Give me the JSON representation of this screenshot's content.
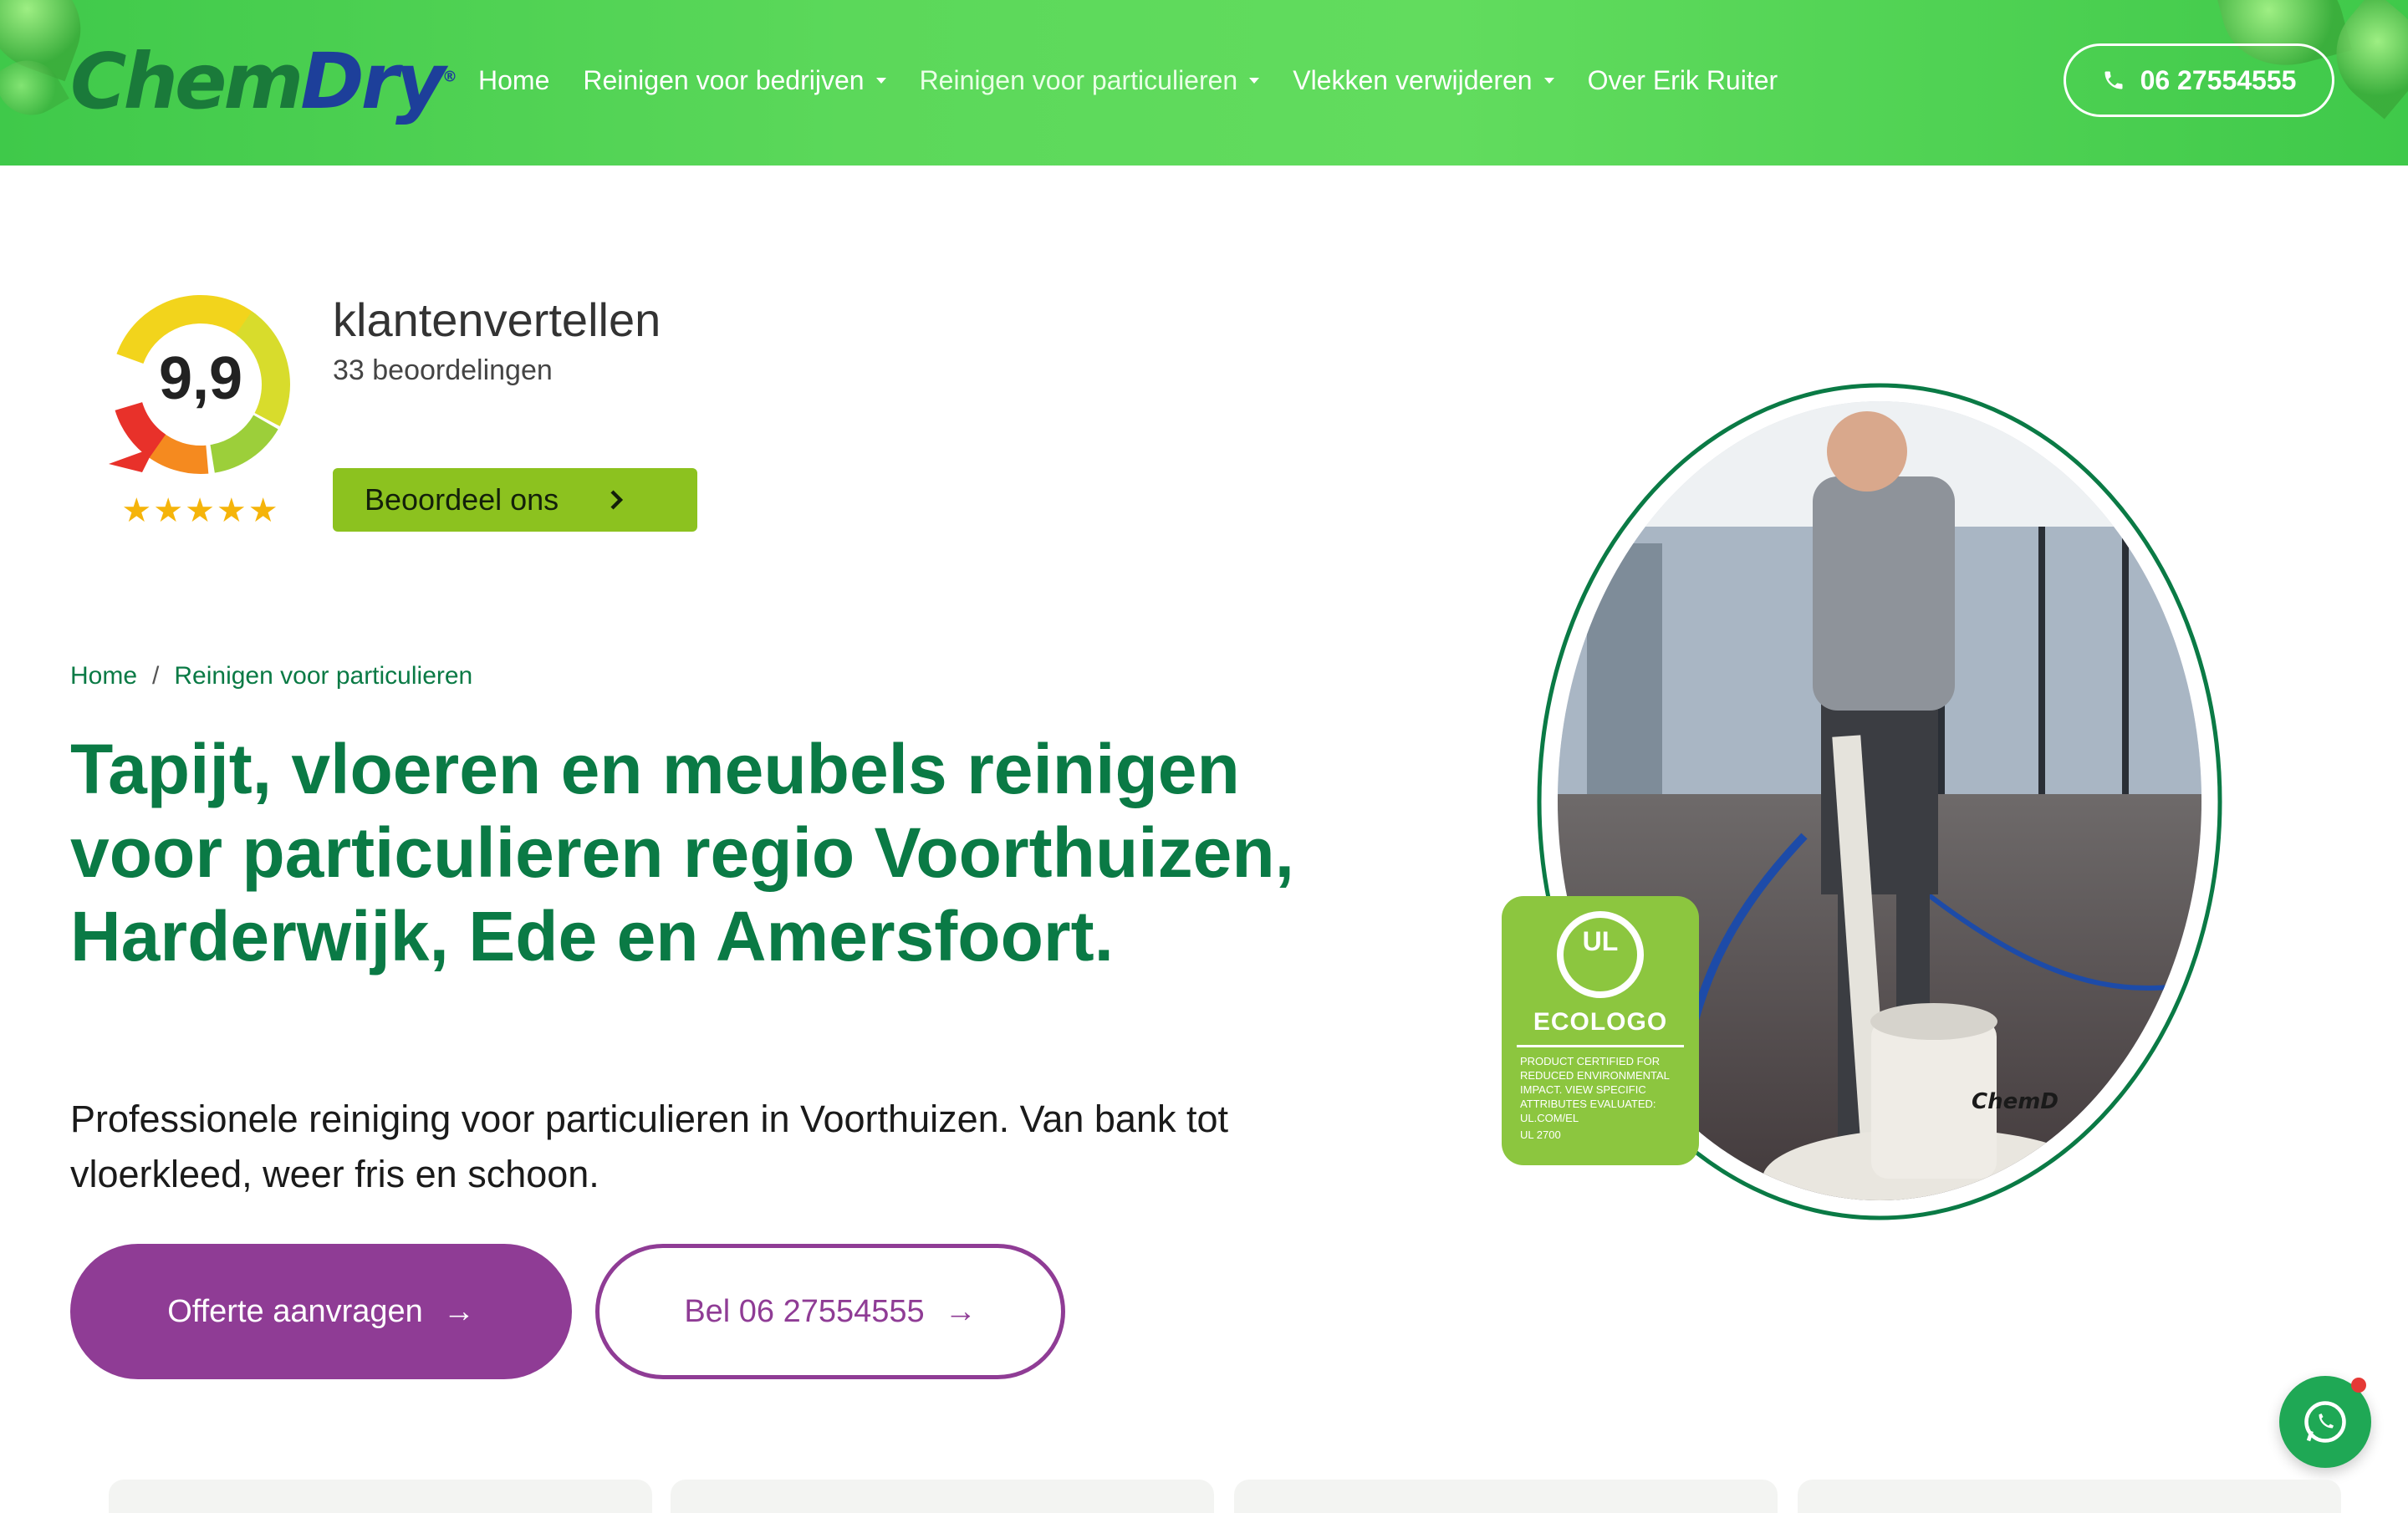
{
  "brand": {
    "logo_chem": "Chem",
    "logo_dry": "Dry",
    "logo_mark": "®"
  },
  "nav": {
    "items": [
      {
        "label": "Home",
        "dropdown": false
      },
      {
        "label": "Reinigen voor bedrijven",
        "dropdown": true
      },
      {
        "label": "Reinigen voor particulieren",
        "dropdown": true
      },
      {
        "label": "Vlekken verwijderen",
        "dropdown": true
      },
      {
        "label": "Over Erik Ruiter",
        "dropdown": false
      }
    ],
    "phone": "06 27554555"
  },
  "rating": {
    "score": "9,9",
    "stars": "★★★★★",
    "source": "klantenvertellen",
    "count": "33 beoordelingen",
    "cta": "Beoordeel ons"
  },
  "breadcrumb": {
    "home": "Home",
    "separator": "/",
    "current": "Reinigen voor particulieren"
  },
  "hero": {
    "title": "Tapijt, vloeren en meubels reinigen voor particulieren regio Voorthuizen, Harderwijk, Ede en Amersfoort.",
    "subtitle": "Professionele reiniging voor particulieren in Voorthuizen. Van bank tot vloerkleed, weer fris en schoon.",
    "cta_primary": "Offerte aanvragen",
    "cta_secondary": "Bel 06 27554555",
    "arrow": "→"
  },
  "ecologo": {
    "mark": "UL",
    "name": "ECOLOGO",
    "text": "PRODUCT CERTIFIED FOR REDUCED ENVIRONMENTAL IMPACT. VIEW SPECIFIC ATTRIBUTES EVALUATED: UL.COM/EL",
    "code": "UL 2700"
  },
  "colors": {
    "header_green": "#4fd350",
    "brand_green": "#0a7a45",
    "rating_green": "#8cc21f",
    "cta_purple": "#8f3c95",
    "whatsapp": "#1fa855"
  },
  "icons": [
    "phone-icon",
    "chevron-right-icon",
    "arrow-right-icon",
    "whatsapp-icon",
    "chevron-down-icon"
  ]
}
